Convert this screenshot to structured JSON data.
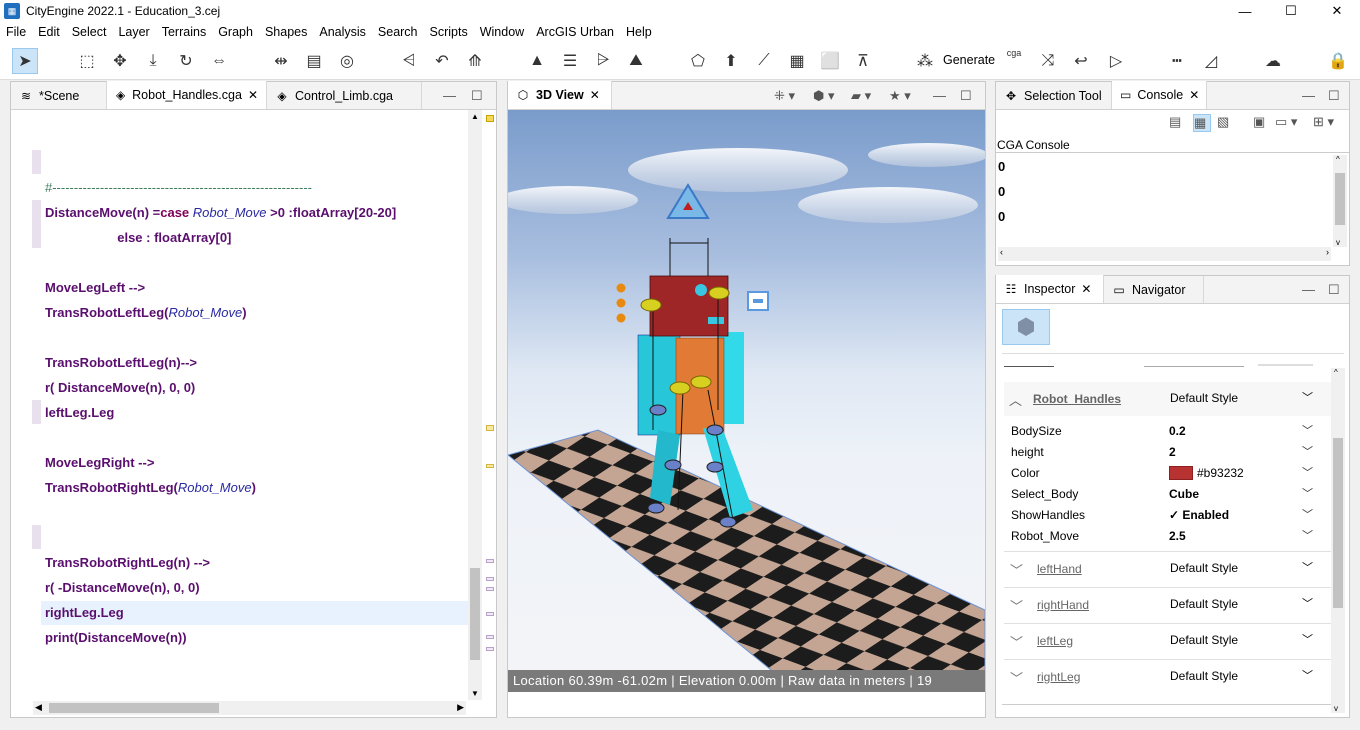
{
  "window": {
    "title": "CityEngine 2022.1 - Education_3.cej",
    "minimize": "—",
    "maximize": "☐",
    "close": "✕"
  },
  "menu": [
    "File",
    "Edit",
    "Select",
    "Layer",
    "Terrains",
    "Graph",
    "Shapes",
    "Analysis",
    "Search",
    "Scripts",
    "Window",
    "ArcGIS Urban",
    "Help"
  ],
  "toolbar": {
    "generate_label": "Generate",
    "cga_label": "cga"
  },
  "editor": {
    "tabs": [
      {
        "label": "*Scene",
        "active": false
      },
      {
        "label": "Robot_Handles.cga",
        "active": true
      },
      {
        "label": "Control_Limb.cga",
        "active": false
      }
    ],
    "lines": [
      {
        "text": "#------------------------------------------------------------",
        "style": "comment"
      },
      {
        "parts": [
          [
            "DistanceMove(n) =",
            ""
          ],
          [
            "case ",
            "kw"
          ],
          [
            "Robot_Move",
            "it"
          ],
          [
            " >0  :floatArray[20-20]",
            ""
          ]
        ]
      },
      {
        "text": "                    else : floatArray[0]",
        "style": "plain"
      },
      {
        "text": "",
        "style": "plain"
      },
      {
        "text": "MoveLegLeft -->",
        "style": "plain"
      },
      {
        "parts": [
          [
            "TransRobotLeftLeg(",
            ""
          ],
          [
            "Robot_Move",
            "it"
          ],
          [
            ")",
            ""
          ]
        ]
      },
      {
        "text": "",
        "style": "plain"
      },
      {
        "text": "TransRobotLeftLeg(n)-->",
        "style": "plain"
      },
      {
        "text": "r( DistanceMove(n), 0, 0)",
        "style": "plain"
      },
      {
        "text": "leftLeg.Leg",
        "style": "plain"
      },
      {
        "text": "",
        "style": "plain"
      },
      {
        "text": "MoveLegRight -->",
        "style": "plain"
      },
      {
        "parts": [
          [
            "TransRobotRightLeg(",
            ""
          ],
          [
            "Robot_Move",
            "it"
          ],
          [
            ")",
            ""
          ]
        ]
      },
      {
        "text": "",
        "style": "plain"
      },
      {
        "text": "",
        "style": "plain"
      },
      {
        "text": "TransRobotRightLeg(n) -->",
        "style": "plain"
      },
      {
        "text": "r( -DistanceMove(n), 0, 0)",
        "style": "plain"
      },
      {
        "text": "rightLeg.Leg",
        "style": "plain"
      },
      {
        "text": "print(DistanceMove(n))",
        "style": "plain"
      }
    ]
  },
  "view3d": {
    "tab_label": "3D View",
    "status": "Location 60.39m -61.02m  |  Elevation 0.00m  |  Raw data in meters  |  19"
  },
  "console": {
    "tabs": [
      {
        "label": "Selection Tool"
      },
      {
        "label": "Console"
      }
    ],
    "heading": "CGA Console",
    "lines": [
      "0",
      "0",
      "0"
    ]
  },
  "inspector": {
    "tabs": [
      {
        "label": "Inspector"
      },
      {
        "label": "Navigator"
      }
    ],
    "rule_group": "Robot_Handles",
    "rule_style": "Default Style",
    "properties": [
      {
        "name": "BodySize",
        "value": "0.2"
      },
      {
        "name": "height",
        "value": "2"
      },
      {
        "name": "Color",
        "value": "#b93232",
        "swatch": "#b93232"
      },
      {
        "name": "Select_Body",
        "value": "Cube"
      },
      {
        "name": "ShowHandles",
        "value": "✓ Enabled"
      },
      {
        "name": "Robot_Move",
        "value": "2.5"
      }
    ],
    "groups": [
      {
        "name": "leftHand",
        "style": "Default Style"
      },
      {
        "name": "rightHand",
        "style": "Default Style"
      },
      {
        "name": "leftLeg",
        "style": "Default Style"
      },
      {
        "name": "rightLeg",
        "style": "Default Style"
      }
    ]
  }
}
